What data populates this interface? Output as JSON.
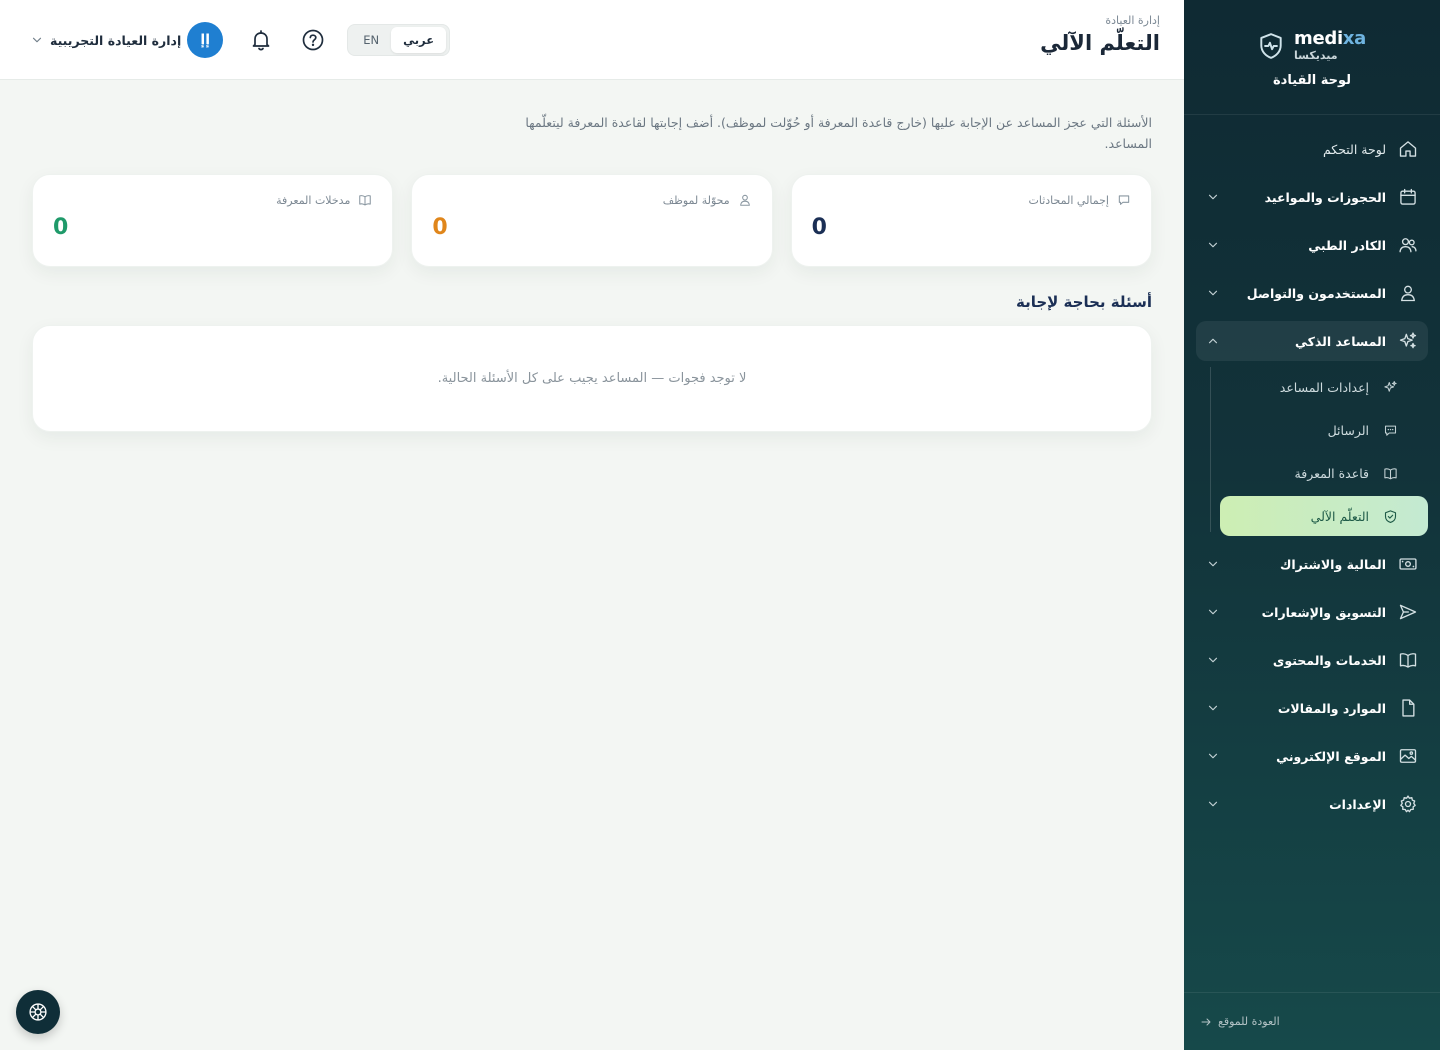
{
  "brand": {
    "name_prefix": "medi",
    "name_suffix": "xa",
    "name_ar": "ميديكسا",
    "subtitle": "لوحة القيادة"
  },
  "sidebar": {
    "items": [
      {
        "label": "لوحة التحكم",
        "icon": "home-icon"
      },
      {
        "label": "الحجوزات والمواعيد",
        "icon": "calendar-icon"
      },
      {
        "label": "الكادر الطبي",
        "icon": "users-icon"
      },
      {
        "label": "المستخدمون والتواصل",
        "icon": "user-icon"
      },
      {
        "label": "المساعد الذكي",
        "icon": "sparkles-icon",
        "expanded": true
      },
      {
        "label": "المالية والاشتراك",
        "icon": "money-icon"
      },
      {
        "label": "التسويق والإشعارات",
        "icon": "send-icon"
      },
      {
        "label": "الخدمات والمحتوى",
        "icon": "book-open-icon"
      },
      {
        "label": "الموارد والمقالات",
        "icon": "file-icon"
      },
      {
        "label": "الموقع الإلكتروني",
        "icon": "image-icon"
      },
      {
        "label": "الإعدادات",
        "icon": "gear-icon"
      }
    ],
    "sub_items": [
      {
        "label": "إعدادات المساعد",
        "icon": "sparkles-icon"
      },
      {
        "label": "الرسائل",
        "icon": "chat-icon"
      },
      {
        "label": "قاعدة المعرفة",
        "icon": "book-icon"
      },
      {
        "label": "التعلّم الآلي",
        "icon": "shield-check-icon",
        "active": true
      }
    ],
    "footer": {
      "back_label": "العودة للموقع"
    }
  },
  "header": {
    "breadcrumb": "إدارة العيادة",
    "title": "التعلّم الآلي",
    "lang": {
      "ar": "عربي",
      "en": "EN",
      "active": "ar"
    },
    "user": {
      "name": "إدارة العيادة التجريبية",
      "initials": "إإ"
    }
  },
  "main": {
    "intro": "الأسئلة التي عجز المساعد عن الإجابة عليها (خارج قاعدة المعرفة أو حُوّلت لموظف). أضف إجابتها لقاعدة المعرفة ليتعلّمها المساعد.",
    "stats": [
      {
        "label": "إجمالي المحادثات",
        "value": "0",
        "icon": "chat-icon",
        "color": "#1b2f55"
      },
      {
        "label": "محوّلة لموظف",
        "value": "0",
        "icon": "user-icon",
        "color": "#e0861b"
      },
      {
        "label": "مدخلات المعرفة",
        "value": "0",
        "icon": "book-icon",
        "color": "#1f9a6a"
      }
    ],
    "section_title": "أسئلة بحاجة لإجابة",
    "empty_message": "لا توجد فجوات — المساعد يجيب على كل الأسئلة الحالية."
  },
  "colors": {
    "accent": "#1f7fd1",
    "sidebar_bg": "#0f2a33",
    "active_item": "#cdeeb3"
  }
}
